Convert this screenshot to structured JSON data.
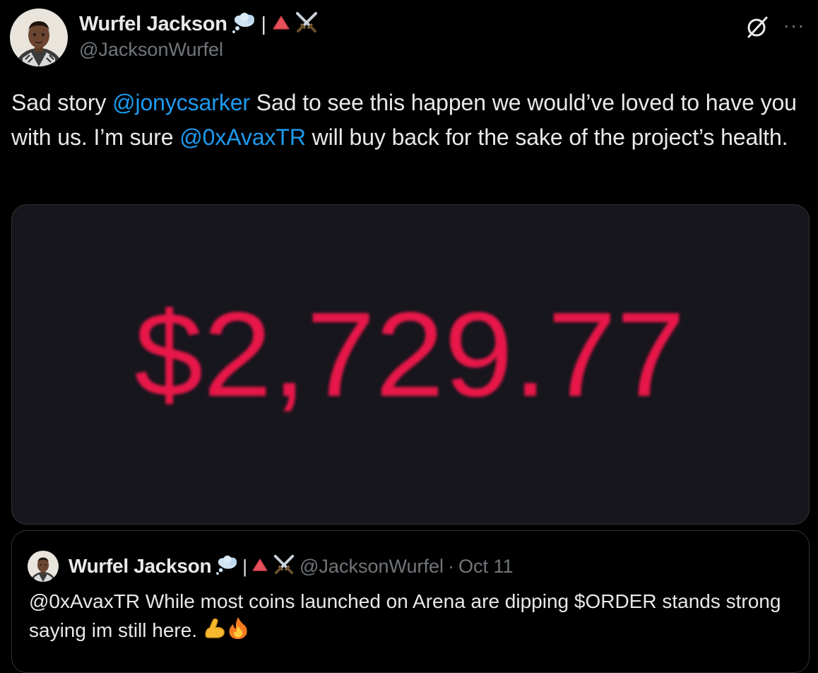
{
  "tweet": {
    "author": {
      "name": "Wurfel Jackson",
      "separator": "|",
      "handle": "@JacksonWurfel"
    },
    "text": {
      "part1": "Sad story ",
      "mention1": "@jonycsarker",
      "part2": " Sad to see this happen we would’ve loved to have you with us. I’m sure ",
      "mention2": "@0xAvaxTR",
      "part3": " will buy back for the sake of the project’s health."
    },
    "media": {
      "amount": "$2,729.77",
      "amount_color": "#e8174a"
    },
    "icons": {
      "grok": "grok-icon",
      "more": "more-icon",
      "more_glyph": "···"
    }
  },
  "quote": {
    "author": {
      "name": "Wurfel Jackson",
      "separator": "|",
      "handle": "@JacksonWurfel",
      "dot": "·",
      "date": "Oct 11"
    },
    "text": {
      "mention": "@0xAvaxTR",
      "body": " While most coins launched on Arena are dipping $ORDER stands strong saying im still here. "
    }
  },
  "colors": {
    "background": "#000000",
    "text": "#e7e9ea",
    "secondary": "#71767b",
    "link": "#1d9bf0",
    "border": "#2f3336"
  }
}
